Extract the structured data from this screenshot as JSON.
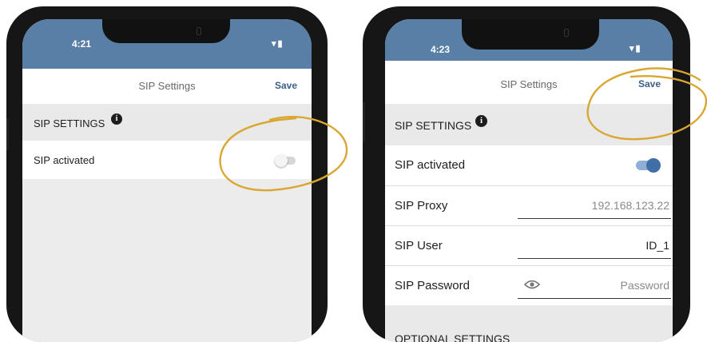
{
  "colors": {
    "status_bar": "#5a7fa6",
    "save_text": "#3b5f86",
    "toggle_on": "#3f6fa6",
    "toggle_off": "#d6d6d6",
    "annotation": "#d9a732"
  },
  "icons": {
    "wifi": "wifi-icon",
    "battery": "battery-icon",
    "info": "info-icon",
    "eye": "eye-icon"
  },
  "left_phone": {
    "status_time": "4:21",
    "status_icons": "▾▮",
    "nav": {
      "title": "SIP Settings",
      "save_label": "Save"
    },
    "section_label": "SIP SETTINGS",
    "info_glyph": "i",
    "rows": [
      {
        "label": "SIP activated",
        "toggle_on": false
      }
    ]
  },
  "right_phone": {
    "status_time": "4:23",
    "status_icons": "▾▮",
    "nav": {
      "title": "SIP Settings",
      "save_label": "Save"
    },
    "section_label": "SIP SETTINGS",
    "info_glyph": "i",
    "rows": [
      {
        "label": "SIP activated",
        "toggle_on": true
      },
      {
        "label": "SIP Proxy",
        "value": "192.168.123.22"
      },
      {
        "label": "SIP User",
        "value": "ID_1"
      },
      {
        "label": "SIP Password",
        "placeholder": "Password"
      }
    ],
    "next_section_label": "OPTIONAL SETTINGS"
  }
}
